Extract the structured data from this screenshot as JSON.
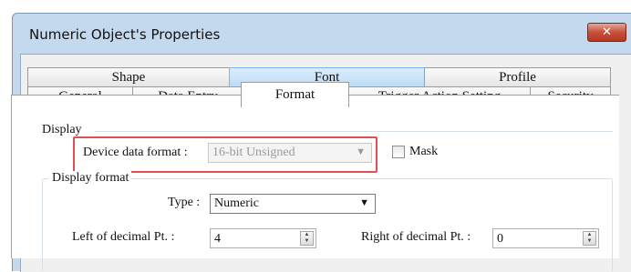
{
  "window": {
    "title": "Numeric Object's Properties",
    "close_glyph": "✕"
  },
  "tabs": {
    "row1": [
      "Shape",
      "Font",
      "Profile"
    ],
    "row2": [
      "General",
      "Data Entry",
      "Format",
      "Trigger Action Setting",
      "Security"
    ],
    "active": "Format",
    "hovered": "Font"
  },
  "display": {
    "group_label": "Display",
    "device_format_label": "Device data format :",
    "device_format_value": "16-bit Unsigned",
    "mask_label": "Mask"
  },
  "display_format": {
    "group_label": "Display format",
    "type_label": "Type :",
    "type_value": "Numeric",
    "left_label": "Left of decimal Pt. :",
    "left_value": "4",
    "right_label": "Right of decimal Pt. :",
    "right_value": "0"
  },
  "colors": {
    "frame": "#c5d9ee",
    "highlight": "#e05050",
    "close": "#c8503b"
  }
}
